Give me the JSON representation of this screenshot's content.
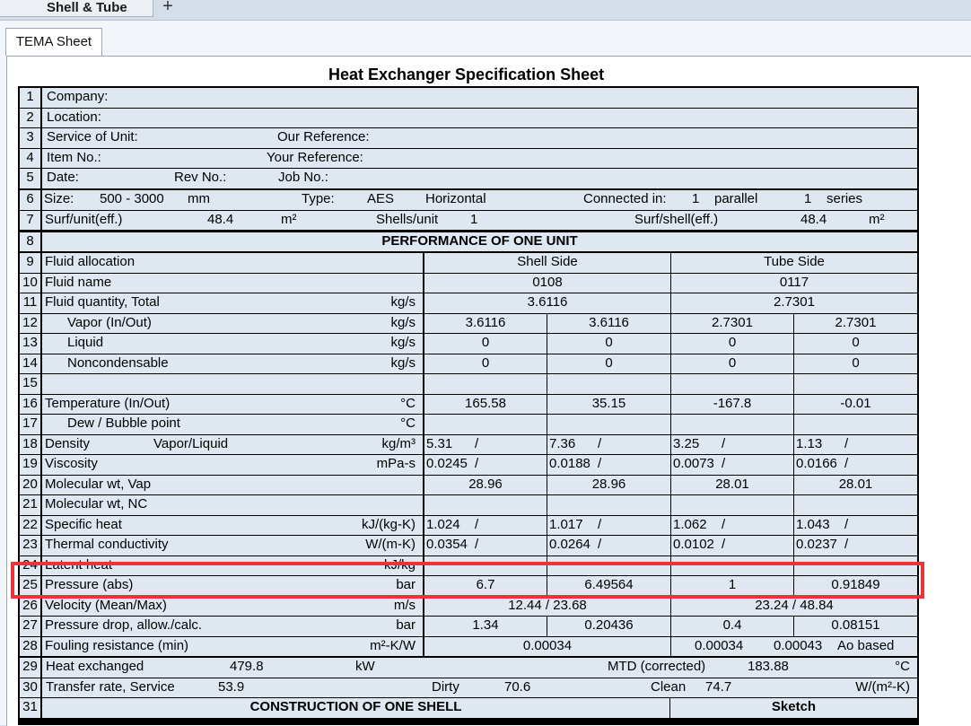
{
  "tabs": {
    "document_tab": "Shell & Tube",
    "add_tab": "+",
    "sheet_tab": "TEMA Sheet"
  },
  "title": "Heat Exchanger Specification Sheet",
  "header": {
    "company": "Company:",
    "location": "Location:",
    "service": "Service of Unit:",
    "our_ref": "Our Reference:",
    "item_no": "Item No.:",
    "your_ref": "Your Reference:",
    "date": "Date:",
    "rev_no": "Rev No.:",
    "job_no": "Job No.:"
  },
  "row6": {
    "size_label": "Size:",
    "size_value": "500 - 3000",
    "size_unit": "mm",
    "type_label": "Type:",
    "type_value": "AES",
    "orientation": "Horizontal",
    "connected_label": "Connected in:",
    "parallel_count": "1",
    "parallel": "parallel",
    "series_count": "1",
    "series": "series"
  },
  "row7": {
    "surf_label": "Surf/unit(eff.)",
    "surf_value": "48.4",
    "surf_unit": "m²",
    "shells_label": "Shells/unit",
    "shells_value": "1",
    "surf_shell_label": "Surf/shell(eff.)",
    "surf_shell_value": "48.4",
    "surf_shell_unit": "m²"
  },
  "performance_header": "PERFORMANCE OF ONE UNIT",
  "shell_side": "Shell Side",
  "tube_side": "Tube Side",
  "rows": [
    {
      "n": "9",
      "label": "Fluid allocation",
      "unit": "",
      "kind": "header_sides"
    },
    {
      "n": "10",
      "label": "Fluid name",
      "unit": "",
      "kind": "merged",
      "shell": "0108",
      "tube": "0117"
    },
    {
      "n": "11",
      "label": "Fluid quantity, Total",
      "unit": "kg/s",
      "kind": "merged",
      "shell": "3.6116",
      "tube": "2.7301"
    },
    {
      "n": "12",
      "label": "Vapor (In/Out)",
      "indent": true,
      "unit": "kg/s",
      "kind": "four",
      "v": [
        "3.6116",
        "3.6116",
        "2.7301",
        "2.7301"
      ]
    },
    {
      "n": "13",
      "label": "Liquid",
      "indent": true,
      "unit": "kg/s",
      "kind": "four",
      "v": [
        "0",
        "0",
        "0",
        "0"
      ]
    },
    {
      "n": "14",
      "label": "Noncondensable",
      "indent": true,
      "unit": "kg/s",
      "kind": "four",
      "v": [
        "0",
        "0",
        "0",
        "0"
      ]
    },
    {
      "n": "15",
      "label": "",
      "unit": "",
      "kind": "four",
      "v": [
        "",
        "",
        "",
        ""
      ]
    },
    {
      "n": "16",
      "label": "Temperature (In/Out)",
      "unit": "°C",
      "kind": "four",
      "v": [
        "165.58",
        "35.15",
        "-167.8",
        "-0.01"
      ]
    },
    {
      "n": "17",
      "label": "Dew / Bubble point",
      "indent": true,
      "unit": "°C",
      "kind": "four",
      "v": [
        "",
        "",
        "",
        ""
      ]
    },
    {
      "n": "18",
      "label": "Density",
      "label2": "Vapor/Liquid",
      "unit": "kg/m³",
      "kind": "slash",
      "v": [
        "5.31",
        "7.36",
        "3.25",
        "1.13"
      ]
    },
    {
      "n": "19",
      "label": "Viscosity",
      "unit": "mPa-s",
      "kind": "slash",
      "v": [
        "0.0245",
        "0.0188",
        "0.0073",
        "0.0166"
      ]
    },
    {
      "n": "20",
      "label": "Molecular wt, Vap",
      "unit": "",
      "kind": "four",
      "v": [
        "28.96",
        "28.96",
        "28.01",
        "28.01"
      ]
    },
    {
      "n": "21",
      "label": "Molecular wt, NC",
      "unit": "",
      "kind": "four",
      "v": [
        "",
        "",
        "",
        ""
      ]
    },
    {
      "n": "22",
      "label": "Specific heat",
      "unit": "kJ/(kg-K)",
      "kind": "slash",
      "v": [
        "1.024",
        "1.017",
        "1.062",
        "1.043"
      ]
    },
    {
      "n": "23",
      "label": "Thermal conductivity",
      "unit": "W/(m-K)",
      "kind": "slash",
      "v": [
        "0.0354",
        "0.0264",
        "0.0102",
        "0.0237"
      ]
    },
    {
      "n": "24",
      "label": "Latent heat",
      "unit": "kJ/kg",
      "kind": "four",
      "v": [
        "",
        "",
        "",
        ""
      ]
    },
    {
      "n": "25",
      "label": "Pressure (abs)",
      "unit": "bar",
      "kind": "four",
      "v": [
        "6.7",
        "6.49564",
        "1",
        "0.91849"
      ]
    },
    {
      "n": "26",
      "label": "Velocity (Mean/Max)",
      "unit": "m/s",
      "kind": "merged",
      "shell": "12.44 / 23.68",
      "tube": "23.24 / 48.84"
    },
    {
      "n": "27",
      "label": "Pressure drop, allow./calc.",
      "unit": "bar",
      "kind": "four",
      "v": [
        "1.34",
        "0.20436",
        "0.4",
        "0.08151"
      ]
    },
    {
      "n": "28",
      "label": "Fouling resistance (min)",
      "unit": "m²-K/W",
      "kind": "fouling",
      "shell": "0.00034",
      "tube1": "0.00034",
      "tube2": "0.00043",
      "tube3": "Ao based"
    }
  ],
  "row29": {
    "label": "Heat exchanged",
    "value": "479.8",
    "unit": "kW",
    "mtd_label": "MTD (corrected)",
    "mtd_value": "183.88",
    "mtd_unit": "°C"
  },
  "row30": {
    "label": "Transfer rate, Service",
    "value": "53.9",
    "dirty_label": "Dirty",
    "dirty_value": "70.6",
    "clean_label": "Clean",
    "clean_value": "74.7",
    "unit": "W/(m²-K)"
  },
  "row31": {
    "construction": "CONSTRUCTION OF ONE SHELL",
    "sketch": "Sketch"
  }
}
